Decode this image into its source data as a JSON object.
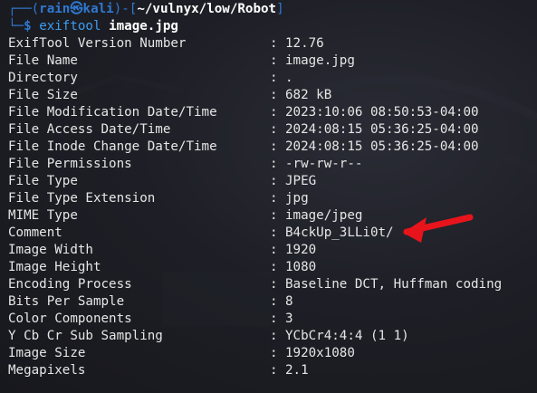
{
  "prompt": {
    "frame_open": "┌──(",
    "user": "rain",
    "skull": "㉿",
    "host": "kali",
    "frame_mid": ")-[",
    "path": "~/vulnyx/low/Robot",
    "frame_close": "]",
    "frame_bottom": "└─",
    "dollar": "$",
    "command": "exiftool",
    "argument": "image.jpg"
  },
  "separator": ":",
  "exif_rows": [
    {
      "key": "ExifTool Version Number",
      "value": "12.76"
    },
    {
      "key": "File Name",
      "value": "image.jpg"
    },
    {
      "key": "Directory",
      "value": "."
    },
    {
      "key": "File Size",
      "value": "682 kB"
    },
    {
      "key": "File Modification Date/Time",
      "value": "2023:10:06 08:50:53-04:00"
    },
    {
      "key": "File Access Date/Time",
      "value": "2024:08:15 05:36:25-04:00"
    },
    {
      "key": "File Inode Change Date/Time",
      "value": "2024:08:15 05:36:25-04:00"
    },
    {
      "key": "File Permissions",
      "value": "-rw-rw-r--"
    },
    {
      "key": "File Type",
      "value": "JPEG"
    },
    {
      "key": "File Type Extension",
      "value": "jpg"
    },
    {
      "key": "MIME Type",
      "value": "image/jpeg"
    },
    {
      "key": "Comment",
      "value": "B4ckUp_3LLi0t/"
    },
    {
      "key": "Image Width",
      "value": "1920"
    },
    {
      "key": "Image Height",
      "value": "1080"
    },
    {
      "key": "Encoding Process",
      "value": "Baseline DCT, Huffman coding"
    },
    {
      "key": "Bits Per Sample",
      "value": "8"
    },
    {
      "key": "Color Components",
      "value": "3"
    },
    {
      "key": "Y Cb Cr Sub Sampling",
      "value": "YCbCr4:4:4 (1 1)"
    },
    {
      "key": "Image Size",
      "value": "1920x1080"
    },
    {
      "key": "Megapixels",
      "value": "2.1"
    }
  ],
  "annotation": {
    "arrow_color": "#e8141c",
    "points_to": "Comment"
  },
  "colors": {
    "background": "#1e1f26",
    "prompt_blue": "#2f78d0",
    "command_blue": "#3b9cf0",
    "text": "#e6e6e6"
  }
}
